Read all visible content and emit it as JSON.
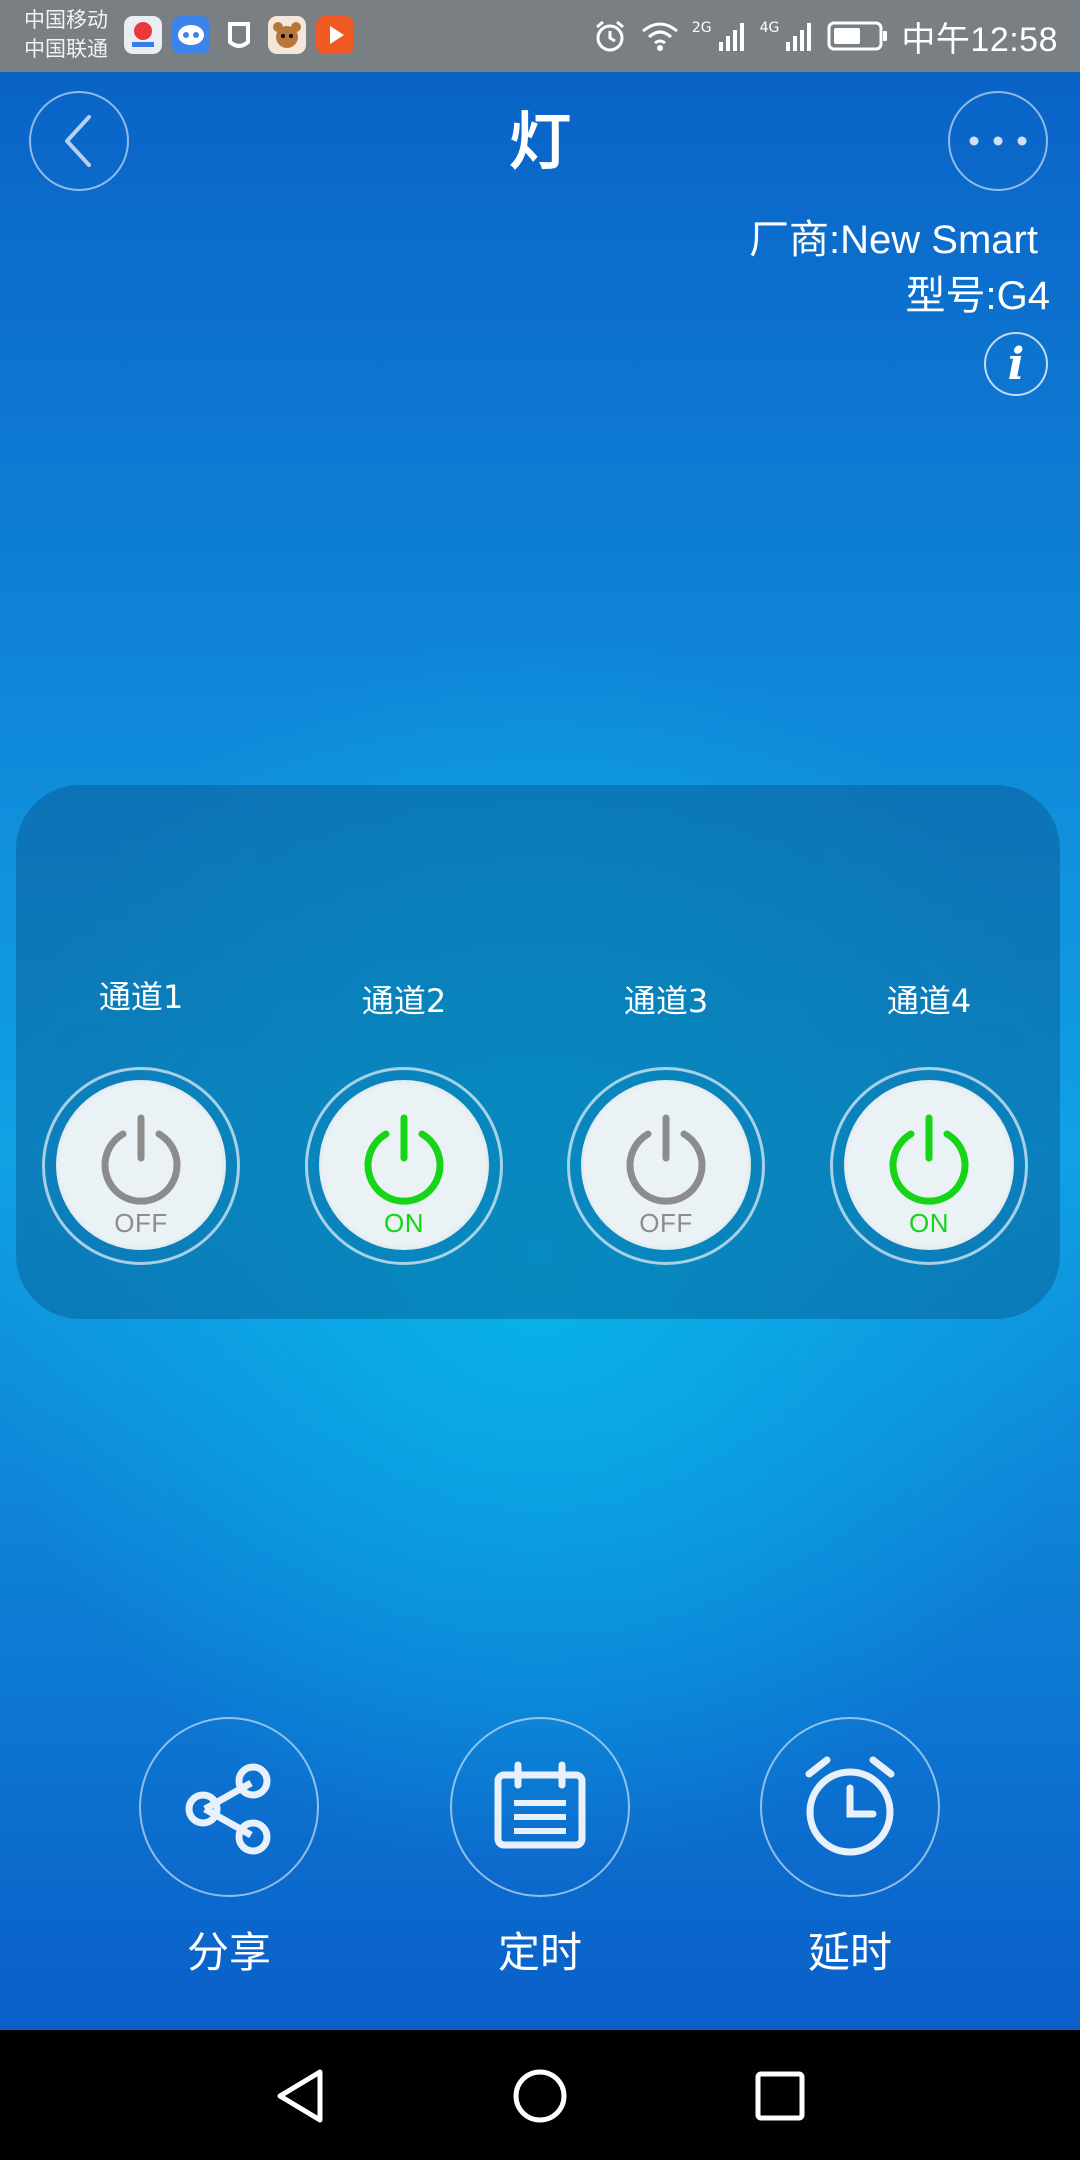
{
  "status_bar": {
    "carrier_1": "中国移动",
    "carrier_2": "中国联通",
    "net_2g": "2G",
    "net_4g": "4G",
    "time": "中午12:58"
  },
  "header": {
    "title": "灯",
    "back_icon": "chevron-left-icon",
    "more_icon": "more-dots-icon"
  },
  "device": {
    "vendor": "厂商:New Smart",
    "model": "型号:G4",
    "info_glyph": "i"
  },
  "channels": [
    {
      "label": "通道1",
      "state": "OFF",
      "on": false
    },
    {
      "label": "通道2",
      "state": "ON",
      "on": true
    },
    {
      "label": "通道3",
      "state": "OFF",
      "on": false
    },
    {
      "label": "通道4",
      "state": "ON",
      "on": true
    }
  ],
  "actions": [
    {
      "label": "分享",
      "icon": "share-icon"
    },
    {
      "label": "定时",
      "icon": "calendar-icon"
    },
    {
      "label": "延时",
      "icon": "alarm-clock-icon"
    }
  ],
  "colors": {
    "on": "#16d416",
    "off": "#8c8c8c",
    "background_top": "#0a63c7",
    "background_glow": "#08b3ea"
  }
}
